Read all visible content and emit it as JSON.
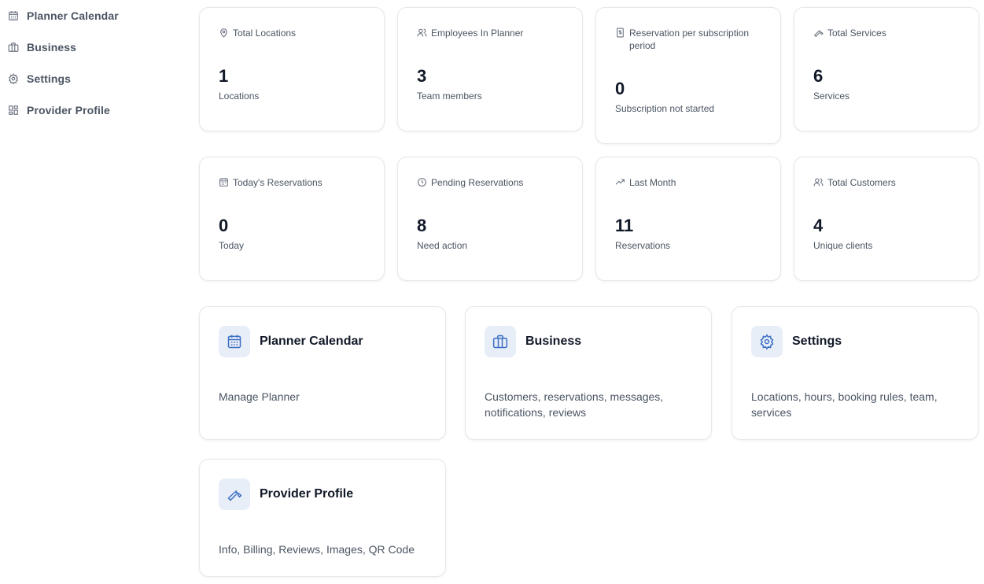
{
  "sidebar": {
    "items": [
      {
        "label": "Planner Calendar",
        "icon": "calendar-icon"
      },
      {
        "label": "Business",
        "icon": "briefcase-icon"
      },
      {
        "label": "Settings",
        "icon": "gear-icon"
      },
      {
        "label": "Provider Profile",
        "icon": "dashboard-icon"
      }
    ]
  },
  "stats": [
    {
      "title": "Total Locations",
      "value": "1",
      "sub": "Locations",
      "icon": "map-pin-icon"
    },
    {
      "title": "Employees In Planner",
      "value": "3",
      "sub": "Team members",
      "icon": "users-icon"
    },
    {
      "title": "Reservation per subscription period",
      "value": "0",
      "sub": "Subscription not started",
      "icon": "receipt-icon"
    },
    {
      "title": "Total Services",
      "value": "6",
      "sub": "Services",
      "icon": "wrench-icon"
    },
    {
      "title": "Today's Reservations",
      "value": "0",
      "sub": "Today",
      "icon": "calendar-icon"
    },
    {
      "title": "Pending Reservations",
      "value": "8",
      "sub": "Need action",
      "icon": "clock-icon"
    },
    {
      "title": "Last Month",
      "value": "11",
      "sub": "Reservations",
      "icon": "trending-up-icon"
    },
    {
      "title": "Total Customers",
      "value": "4",
      "sub": "Unique clients",
      "icon": "users-icon"
    }
  ],
  "nav_cards": [
    {
      "title": "Planner Calendar",
      "desc": "Manage Planner",
      "icon": "calendar-icon"
    },
    {
      "title": "Business",
      "desc": "Customers, reservations, messages, notifications, reviews",
      "icon": "briefcase-icon"
    },
    {
      "title": "Settings",
      "desc": "Locations, hours, booking rules, team, services",
      "icon": "gear-icon"
    },
    {
      "title": "Provider Profile",
      "desc": "Info, Billing, Reviews, Images, QR Code",
      "icon": "wrench-icon"
    }
  ],
  "colors": {
    "accent": "#3b6fc4",
    "icon_bg": "#e8eef8",
    "border": "#e5e7eb",
    "muted_text": "#4b5563"
  }
}
